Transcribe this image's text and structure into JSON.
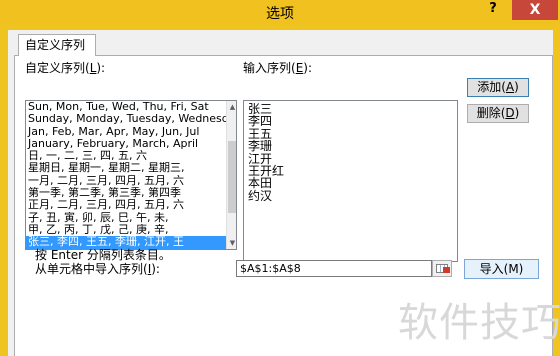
{
  "window": {
    "title": "选项",
    "help": "?",
    "close": "X"
  },
  "tab": {
    "label": "自定义序列"
  },
  "left": {
    "label": "自定义序列(",
    "label_key": "L",
    "label_end": "):",
    "items": [
      "Sun, Mon, Tue, Wed, Thu, Fri, Sat",
      "Sunday, Monday, Tuesday, Wednesday",
      "Jan, Feb, Mar, Apr, May, Jun, Jul",
      "January, February, March, April",
      "日, 一, 二, 三, 四, 五, 六",
      "星期日, 星期一, 星期二, 星期三,",
      "一月, 二月, 三月, 四月, 五月, 六",
      "第一季, 第二季, 第三季, 第四季",
      "正月, 二月, 三月, 四月, 五月, 六",
      "子, 丑, 寅, 卯, 辰, 巳, 午, 未,",
      "甲, 乙, 丙, 丁, 戊, 己, 庚, 辛,",
      "张三, 李四, 王五, 李珊, 江开, 王"
    ],
    "selected_index": 11
  },
  "right": {
    "label": "输入序列(",
    "label_key": "E",
    "label_end": "):",
    "entries": [
      "张三",
      "李四",
      "王五",
      "李珊",
      "江开",
      "王开红",
      "本田",
      "约汉"
    ]
  },
  "buttons": {
    "add": "添加(",
    "add_key": "A",
    "add_end": ")",
    "delete": "删除(",
    "delete_key": "D",
    "delete_end": ")",
    "import": "导入(M)"
  },
  "hint": "按 Enter 分隔列表条目。",
  "import_label": "从单元格中导入序列(",
  "import_label_key": "I",
  "import_label_end": "):",
  "range_value": "$A$1:$A$8",
  "watermark": "软件技巧",
  "colors": {
    "titlebar": "#f1c21f",
    "close": "#c7473a",
    "selection": "#3399ff"
  }
}
